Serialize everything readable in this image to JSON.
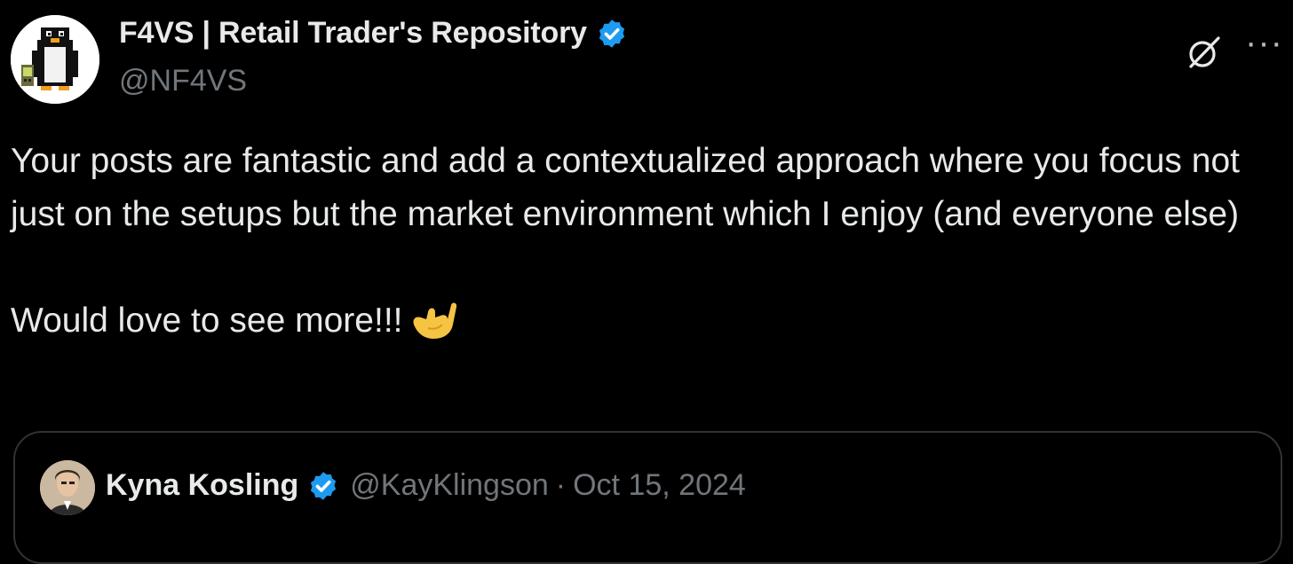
{
  "author": {
    "display_name": "F4VS | Retail Trader's Repository",
    "handle": "@NF4VS",
    "verified_icon": "verified-badge-icon",
    "avatar_icon": "pixel-penguin-avatar"
  },
  "header_actions": {
    "grok_icon": "grok-slash-icon",
    "more_icon": "more-options-icon",
    "more_label": "···"
  },
  "tweet": {
    "paragraph_1": "Your posts are fantastic and add a contextualized approach where you focus not just on the setups but the market environment which I enjoy (and everyone else)",
    "paragraph_2": "Would love to see more!!!",
    "emoji": "call-me-hand-emoji"
  },
  "quoted": {
    "display_name": "Kyna Kosling",
    "handle": "@KayKlingson",
    "separator": "·",
    "date": "Oct 15, 2024"
  },
  "colors": {
    "background": "#000000",
    "primary_text": "#e7e9ea",
    "secondary_text": "#71767b",
    "verified_blue": "#1d9bf0",
    "card_border": "#2f3336"
  }
}
